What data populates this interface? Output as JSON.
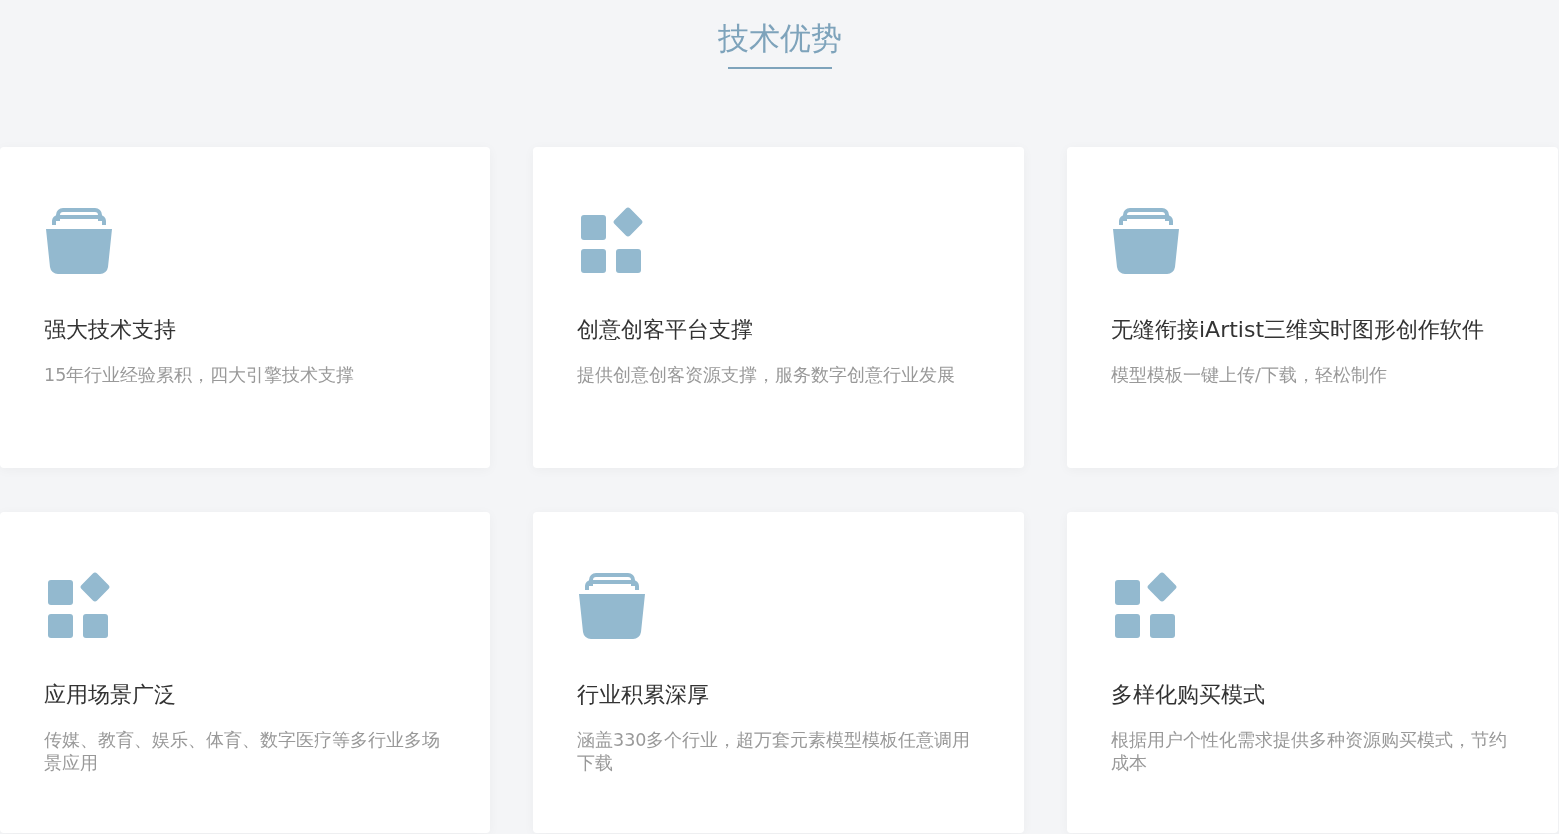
{
  "heading": "技术优势",
  "cards": [
    {
      "kind": "basket",
      "title": "强大技术支持",
      "description": "15年行业经验累积，四大引擎技术支撑"
    },
    {
      "kind": "apps",
      "title": "创意创客平台支撑",
      "description": "提供创意创客资源支撑，服务数字创意行业发展"
    },
    {
      "kind": "basket",
      "title": "无缝衔接iArtist三维实时图形创作软件",
      "description": "模型模板一键上传/下载，轻松制作"
    },
    {
      "kind": "apps",
      "title": "应用场景广泛",
      "description": "传媒、教育、娱乐、体育、数字医疗等多行业多场景应用"
    },
    {
      "kind": "basket",
      "title": "行业积累深厚",
      "description": "涵盖330多个行业，超万套元素模型模板任意调用下载"
    },
    {
      "kind": "apps",
      "title": "多样化购买模式",
      "description": "根据用户个性化需求提供多种资源购买模式，节约成本"
    }
  ]
}
